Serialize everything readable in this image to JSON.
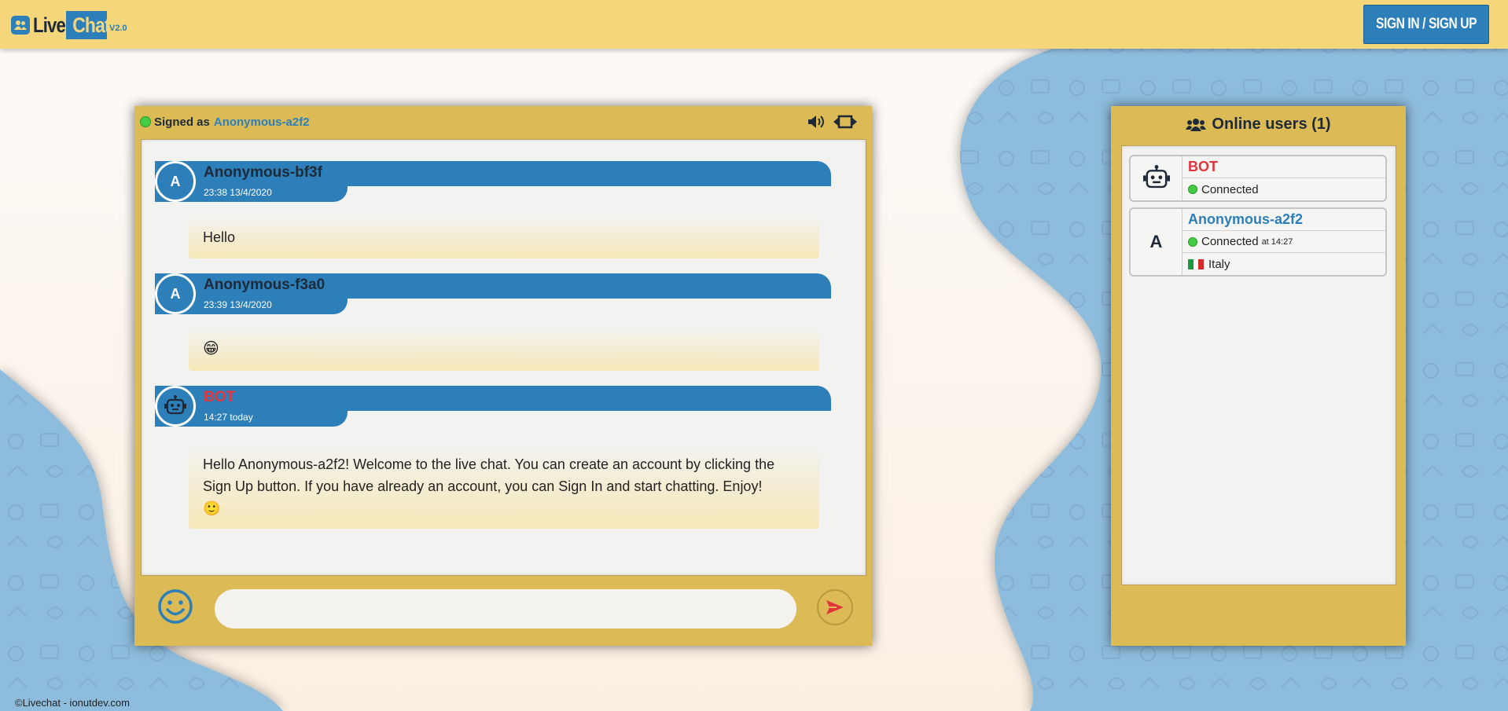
{
  "brand": {
    "live": "Live",
    "chat": "Chat",
    "version": "V2.0"
  },
  "auth": {
    "signin_label": "SIGN IN / SIGN UP"
  },
  "chat": {
    "signed_label": "Signed as",
    "signed_user": "Anonymous-a2f2",
    "icons": {
      "sound": "volume-icon",
      "resize": "expand-horizontal-icon"
    },
    "messages": [
      {
        "avatar": "A",
        "author": "Anonymous-bf3f",
        "time": "23:38 13/4/2020",
        "text": "Hello"
      },
      {
        "avatar": "A",
        "author": "Anonymous-f3a0",
        "time": "23:39 13/4/2020",
        "text": "😁"
      },
      {
        "avatar": "robot-icon",
        "author": "BOT",
        "time": "14:27 today",
        "text": "Hello Anonymous-a2f2! Welcome to the live chat. You can create an account by clicking the Sign Up button. If you have already an account, you can Sign In and start chatting. Enjoy! 🙂"
      }
    ],
    "input": {
      "value": "",
      "placeholder": ""
    }
  },
  "users": {
    "title": "Online users (1)",
    "list": [
      {
        "avatar": "robot-icon",
        "name": "BOT",
        "status": "Connected"
      },
      {
        "avatar": "A",
        "name": "Anonymous-a2f2",
        "status": "Connected",
        "status_at": "at 14:27",
        "country": "Italy"
      }
    ]
  },
  "colors": {
    "accent_blue": "#2c7fb8",
    "panel_gold": "#dcbb56",
    "topbar": "#f5d67a",
    "bot_red": "#e0353d",
    "online_green": "#44cc44"
  },
  "footer": {
    "text": "©Livechat - ionutdev.com"
  }
}
